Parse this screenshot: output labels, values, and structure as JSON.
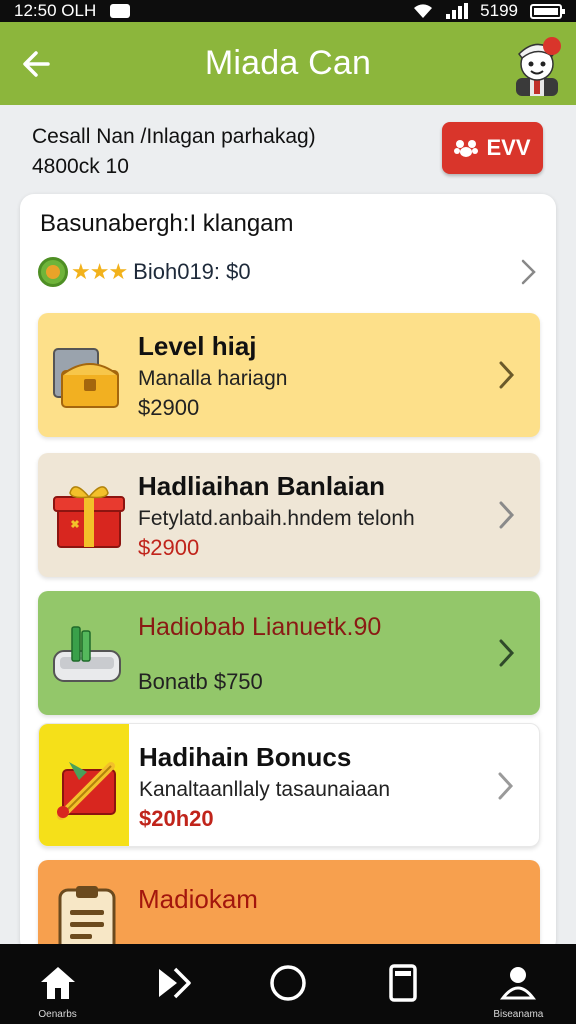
{
  "status_bar": {
    "time": "12:50 OLH",
    "battery_label": "5199"
  },
  "app_bar": {
    "title": "Miada Can",
    "back_icon": "arrow-left-icon",
    "avatar_icon": "mascot-avatar-icon"
  },
  "summary": {
    "line1": "Cesall Nan /Inlagan parhakag)",
    "line2": "4800ck 10"
  },
  "ev_button": {
    "label": "EVV",
    "icon": "paw-icon",
    "color": "#d9352b"
  },
  "panel": {
    "title": "Basunabergh:I klangam",
    "rating": {
      "text": "Bioh019: $0",
      "stars": "★★★"
    }
  },
  "cards": [
    {
      "title": "Level hiaj",
      "subtitle": "Manalla hariagn",
      "price": "$2900",
      "icon": "treasure-chest-icon",
      "color": "#fde08a"
    },
    {
      "title": "Hadliaihan Banlaian",
      "subtitle": "Fetylatd.anbaih.hndem telonh",
      "price": "$2900",
      "icon": "gift-box-icon",
      "color": "#efe6d6"
    },
    {
      "title": "Hadiobab Lianuetk.90",
      "subtitle": "",
      "price": "Bonatb $750",
      "icon": "cash-stack-icon",
      "color": "#93c76a"
    },
    {
      "title": "Hadihain Bonucs",
      "subtitle": "Kanaltaanllaly tasaunaiaan",
      "price": "$20h20",
      "icon": "wrapped-gift-icon",
      "color": "#ffffff"
    },
    {
      "title": "Madiokam",
      "subtitle": "",
      "price": "",
      "icon": "clipboard-icon",
      "color": "#f7a04e"
    }
  ],
  "nav": [
    {
      "label": "Oenarbs",
      "icon": "home-icon"
    },
    {
      "label": "",
      "icon": "play-forward-icon"
    },
    {
      "label": "",
      "icon": "circle-icon"
    },
    {
      "label": "",
      "icon": "square-icon"
    },
    {
      "label": "Biseanama",
      "icon": "profile-icon"
    }
  ]
}
